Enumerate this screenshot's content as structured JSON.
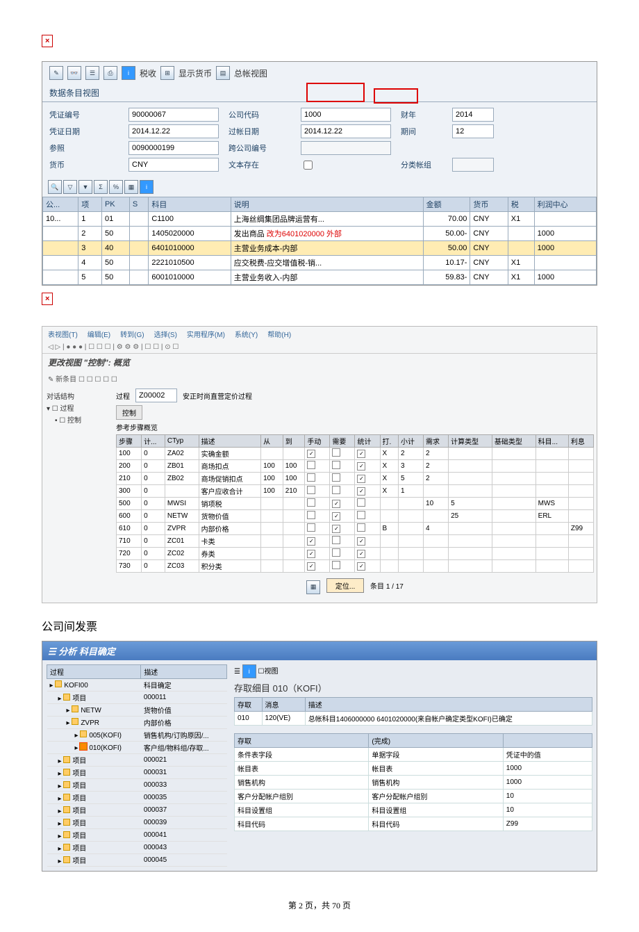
{
  "s1": {
    "toolbar_tax": "税收",
    "toolbar_curr": "显示货币",
    "toolbar_gl": "总帐视图",
    "tab": "数据条目视图",
    "labels": {
      "doc": "凭证编号",
      "date": "凭证日期",
      "ref": "参照",
      "curr": "货币",
      "cocode": "公司代码",
      "pdate": "过帐日期",
      "cross": "跨公司编号",
      "texist": "文本存在",
      "fy": "财年",
      "period": "期间",
      "ledger": "分类帐组"
    },
    "vals": {
      "doc": "90000067",
      "date": "2014.12.22",
      "ref": "0090000199",
      "curr": "CNY",
      "cocode": "1000",
      "pdate": "2014.12.22",
      "fy": "2014",
      "period": "12"
    },
    "cols": [
      "公...",
      "项",
      "PK",
      "S",
      "科目",
      "说明",
      "金额",
      "货币",
      "税",
      "利润中心"
    ],
    "rows": [
      {
        "co": "10...",
        "i": "1",
        "pk": "01",
        "acc": "C1100",
        "desc": "上海丝绸集团品牌运营有...",
        "amt": "70.00",
        "cur": "CNY",
        "tax": "X1",
        "pc": ""
      },
      {
        "co": "",
        "i": "2",
        "pk": "50",
        "acc": "1405020000",
        "desc": "发出商品",
        "amt": "50.00-",
        "cur": "CNY",
        "tax": "",
        "pc": "1000",
        "note": "改为6401020000",
        "ext": "外部"
      },
      {
        "co": "",
        "i": "3",
        "pk": "40",
        "acc": "6401010000",
        "desc": "主营业务成本-内部",
        "amt": "50.00",
        "cur": "CNY",
        "tax": "",
        "pc": "1000",
        "hl": true
      },
      {
        "co": "",
        "i": "4",
        "pk": "50",
        "acc": "2221010500",
        "desc": "应交税费-应交增值税-销...",
        "amt": "10.17-",
        "cur": "CNY",
        "tax": "X1",
        "pc": ""
      },
      {
        "co": "",
        "i": "5",
        "pk": "50",
        "acc": "6001010000",
        "desc": "主营业务收入-内部",
        "amt": "59.83-",
        "cur": "CNY",
        "tax": "X1",
        "pc": "1000"
      }
    ]
  },
  "s2": {
    "menu": [
      "表视图(T)",
      "编辑(E)",
      "转到(G)",
      "选择(S)",
      "实用程序(M)",
      "系统(Y)",
      "帮助(H)"
    ],
    "title": "更改视图 \"控制\": 概览",
    "new": "新条目",
    "tree": {
      "root": "对话结构",
      "items": [
        "过程",
        "控制"
      ]
    },
    "proc": {
      "lbl": "过程",
      "code": "Z00002",
      "desc": "安正时尚直营定价过程"
    },
    "tab": "控制",
    "subtitle": "参考步骤概览",
    "cols": [
      "步骤",
      "计...",
      "CTyp",
      "描述",
      "从",
      "到",
      "手动",
      "需要",
      "统计",
      "打.",
      "小计",
      "需求",
      "计算类型",
      "基础类型",
      "科目...",
      "利息"
    ],
    "rows": [
      {
        "s": "100",
        "c": "0",
        "t": "ZA02",
        "d": "实确金额",
        "f": "",
        "to": "",
        "m": "✓",
        "r": "",
        "st": "✓",
        "p": "X",
        "sub": "2",
        "req": "2"
      },
      {
        "s": "200",
        "c": "0",
        "t": "ZB01",
        "d": "商场扣点",
        "f": "100",
        "to": "100",
        "m": "",
        "r": "",
        "st": "✓",
        "p": "X",
        "sub": "3",
        "req": "2"
      },
      {
        "s": "210",
        "c": "0",
        "t": "ZB02",
        "d": "商场促销扣点",
        "f": "100",
        "to": "100",
        "m": "",
        "r": "",
        "st": "✓",
        "p": "X",
        "sub": "5",
        "req": "2"
      },
      {
        "s": "300",
        "c": "0",
        "t": "",
        "d": "客户应收合计",
        "f": "100",
        "to": "210",
        "m": "",
        "r": "",
        "st": "✓",
        "p": "X",
        "sub": "1",
        "req": ""
      },
      {
        "s": "500",
        "c": "0",
        "t": "MWSI",
        "d": "销项税",
        "f": "",
        "to": "",
        "m": "",
        "r": "✓",
        "st": "",
        "p": "",
        "sub": "",
        "req": "10",
        "calc": "5",
        "acc": "MWS"
      },
      {
        "s": "600",
        "c": "0",
        "t": "NETW",
        "d": "货物价值",
        "f": "",
        "to": "",
        "m": "",
        "r": "✓",
        "st": "",
        "p": "",
        "sub": "",
        "req": "",
        "calc": "25",
        "acc": "ERL"
      },
      {
        "s": "610",
        "c": "0",
        "t": "ZVPR",
        "d": "内部价格",
        "f": "",
        "to": "",
        "m": "",
        "r": "✓",
        "st": "",
        "p": "B",
        "sub": "",
        "req": "4",
        "li": "Z99"
      },
      {
        "s": "710",
        "c": "0",
        "t": "ZC01",
        "d": "卡类",
        "f": "",
        "to": "",
        "m": "✓",
        "r": "",
        "st": "✓",
        "p": ""
      },
      {
        "s": "720",
        "c": "0",
        "t": "ZC02",
        "d": "券类",
        "f": "",
        "to": "",
        "m": "✓",
        "r": "",
        "st": "✓",
        "p": ""
      },
      {
        "s": "730",
        "c": "0",
        "t": "ZC03",
        "d": "积分类",
        "f": "",
        "to": "",
        "m": "✓",
        "r": "",
        "st": "✓",
        "p": ""
      }
    ],
    "pos": "定位...",
    "page": "条目 1 / 17"
  },
  "section": "公司间发票",
  "s3": {
    "title": "分析 科目确定",
    "cols": [
      "过程",
      "描述"
    ],
    "tree": [
      {
        "n": "KOFI00",
        "d": "科目确定",
        "lvl": 0
      },
      {
        "n": "项目",
        "d": "000011",
        "lvl": 1
      },
      {
        "n": "NETW",
        "d": "货物价值",
        "lvl": 2
      },
      {
        "n": "ZVPR",
        "d": "内部价格",
        "lvl": 2
      },
      {
        "n": "005(KOFI)",
        "d": "销售机构/订购原因/...",
        "lvl": 3
      },
      {
        "n": "010(KOFI)",
        "d": "客户组/物料组/存取...",
        "lvl": 3,
        "sel": true
      },
      {
        "n": "项目",
        "d": "000021",
        "lvl": 1
      },
      {
        "n": "项目",
        "d": "000031",
        "lvl": 1
      },
      {
        "n": "项目",
        "d": "000033",
        "lvl": 1
      },
      {
        "n": "项目",
        "d": "000035",
        "lvl": 1
      },
      {
        "n": "项目",
        "d": "000037",
        "lvl": 1
      },
      {
        "n": "项目",
        "d": "000039",
        "lvl": 1
      },
      {
        "n": "项目",
        "d": "000041",
        "lvl": 1
      },
      {
        "n": "项目",
        "d": "000043",
        "lvl": 1
      },
      {
        "n": "项目",
        "d": "000045",
        "lvl": 1
      }
    ],
    "rtitle": "存取细目 010（KOFI）",
    "t1": {
      "cols": [
        "存取",
        "消息",
        "描述"
      ],
      "row": [
        "010",
        "120(VE)",
        "总帐科目1406000000 6401020000(来自帐户确定类型KOFI)已确定"
      ]
    },
    "t2": {
      "cols": [
        "存取",
        "(完成)"
      ],
      "rows": [
        [
          "条件表字段",
          "单据字段",
          "凭证中的值"
        ],
        [
          "帐目表",
          "帐目表",
          "1000"
        ],
        [
          "销售机构",
          "销售机构",
          "1000"
        ],
        [
          "客户分配帐户组别",
          "客户分配帐户组别",
          "10"
        ],
        [
          "科目设置组",
          "科目设置组",
          "10"
        ],
        [
          "科目代码",
          "科目代码",
          "Z99"
        ]
      ]
    }
  },
  "footer": {
    "p": "第",
    "n": "2",
    "of": "页，共",
    "t": "70",
    "pg": "页"
  }
}
